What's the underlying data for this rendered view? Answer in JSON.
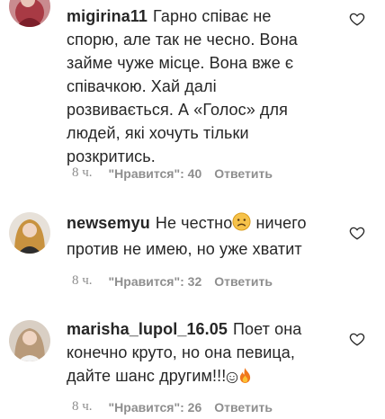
{
  "comments": [
    {
      "username": "migirina11",
      "text_lines": [
        "Гарно співає не",
        "спорю, але так не чесно. Вона",
        "займе чуже місце. Вона вже є",
        "співачкою. Хай далі",
        "розвивається. А «Голос» для",
        "людей, які хочуть тільки",
        "розкритись."
      ],
      "time": "8 ч.",
      "likes": "\"Нравится\": 40",
      "reply": "Ответить"
    },
    {
      "username": "newsemyu",
      "text_lines": [
        "Не честно",
        "ничего",
        "против не имею, но уже хватит"
      ],
      "emoji": "sad-face",
      "time": "8 ч.",
      "likes": "\"Нравится\": 32",
      "reply": "Ответить"
    },
    {
      "username": "marisha_lupol_16.05",
      "text_lines": [
        "Поет она",
        "конечно круто, но она певица,",
        "дайте шанс другим!!!"
      ],
      "emojis": [
        "smile-outline",
        "fire"
      ],
      "time": "8 ч.",
      "likes": "\"Нравится\": 26",
      "reply": "Ответить"
    }
  ],
  "colors": {
    "text": "#262626",
    "meta": "#8e8e8e",
    "heart_stroke": "#262626"
  }
}
